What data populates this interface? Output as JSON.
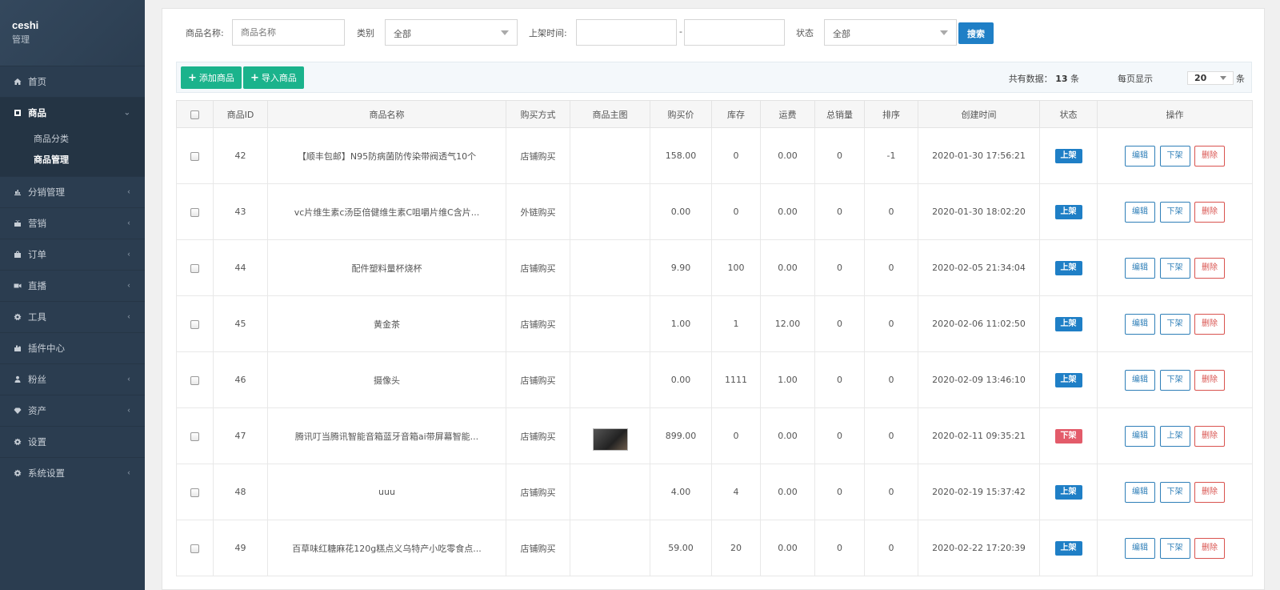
{
  "brand": {
    "name": "ceshi",
    "sub": "管理"
  },
  "sidebar": {
    "items": [
      {
        "key": "home",
        "label": "首页",
        "icon": "home-icon",
        "arrow": false
      },
      {
        "key": "goods",
        "label": "商品",
        "icon": "product-icon",
        "arrow": true,
        "open": true,
        "children": [
          {
            "label": "商品分类"
          },
          {
            "label": "商品管理",
            "active": true
          }
        ]
      },
      {
        "key": "distribution",
        "label": "分销管理",
        "icon": "distribution-icon",
        "arrow": true
      },
      {
        "key": "marketing",
        "label": "营销",
        "icon": "gift-icon",
        "arrow": true
      },
      {
        "key": "orders",
        "label": "订单",
        "icon": "cart-icon",
        "arrow": true
      },
      {
        "key": "live",
        "label": "直播",
        "icon": "video-icon",
        "arrow": true
      },
      {
        "key": "tools",
        "label": "工具",
        "icon": "gear-icon",
        "arrow": true
      },
      {
        "key": "plugins",
        "label": "插件中心",
        "icon": "plugin-icon",
        "arrow": false
      },
      {
        "key": "fans",
        "label": "粉丝",
        "icon": "user-icon",
        "arrow": true
      },
      {
        "key": "assets",
        "label": "资产",
        "icon": "diamond-icon",
        "arrow": true
      },
      {
        "key": "settings",
        "label": "设置",
        "icon": "gear-icon",
        "arrow": false
      },
      {
        "key": "system",
        "label": "系统设置",
        "icon": "gear-icon",
        "arrow": true
      }
    ]
  },
  "filters": {
    "name_label": "商品名称:",
    "name_placeholder": "商品名称",
    "category_label": "类别",
    "category_value": "全部",
    "time_label": "上架时间:",
    "time_separator": "-",
    "status_label": "状态",
    "status_value": "全部",
    "search_label": "搜索"
  },
  "toolbar": {
    "add_label": "添加商品",
    "import_label": "导入商品",
    "total_prefix": "共有数据：",
    "total_count": "13",
    "total_suffix": "条",
    "perpage_label": "每页显示",
    "perpage_value": "20",
    "perpage_unit": "条"
  },
  "table": {
    "headers": [
      "商品ID",
      "商品名称",
      "购买方式",
      "商品主图",
      "购买价",
      "库存",
      "运费",
      "总销量",
      "排序",
      "创建时间",
      "状态",
      "操作"
    ],
    "rows": [
      {
        "id": "42",
        "name": "【顺丰包邮】N95防病菌防传染带阀透气10个",
        "buy": "店铺购买",
        "image": "",
        "price": "158.00",
        "stock": "0",
        "freight": "0.00",
        "sales": "0",
        "sort": "-1",
        "created": "2020-01-30 17:56:21",
        "status": "上架",
        "on": true,
        "edit": "编辑",
        "toggle": "下架",
        "del": "删除"
      },
      {
        "id": "43",
        "name": "vc片维生素c汤臣倍健维生素C咀嚼片维C含片...",
        "buy": "外链购买",
        "image": "",
        "price": "0.00",
        "stock": "0",
        "freight": "0.00",
        "sales": "0",
        "sort": "0",
        "created": "2020-01-30 18:02:20",
        "status": "上架",
        "on": true,
        "edit": "编辑",
        "toggle": "下架",
        "del": "删除"
      },
      {
        "id": "44",
        "name": "配件塑料量杯烧杯",
        "buy": "店铺购买",
        "image": "",
        "price": "9.90",
        "stock": "100",
        "freight": "0.00",
        "sales": "0",
        "sort": "0",
        "created": "2020-02-05 21:34:04",
        "status": "上架",
        "on": true,
        "edit": "编辑",
        "toggle": "下架",
        "del": "删除"
      },
      {
        "id": "45",
        "name": "黄金茶",
        "buy": "店铺购买",
        "image": "",
        "price": "1.00",
        "stock": "1",
        "freight": "12.00",
        "sales": "0",
        "sort": "0",
        "created": "2020-02-06 11:02:50",
        "status": "上架",
        "on": true,
        "edit": "编辑",
        "toggle": "下架",
        "del": "删除"
      },
      {
        "id": "46",
        "name": "摄像头",
        "buy": "店铺购买",
        "image": "",
        "price": "0.00",
        "stock": "1111",
        "freight": "1.00",
        "sales": "0",
        "sort": "0",
        "created": "2020-02-09 13:46:10",
        "status": "上架",
        "on": true,
        "edit": "编辑",
        "toggle": "下架",
        "del": "删除"
      },
      {
        "id": "47",
        "name": "腾讯叮当腾讯智能音箱蓝牙音箱ai带屏幕智能...",
        "buy": "店铺购买",
        "image": "thumbnail",
        "price": "899.00",
        "stock": "0",
        "freight": "0.00",
        "sales": "0",
        "sort": "0",
        "created": "2020-02-11 09:35:21",
        "status": "下架",
        "on": false,
        "edit": "编辑",
        "toggle": "上架",
        "del": "删除"
      },
      {
        "id": "48",
        "name": "uuu",
        "buy": "店铺购买",
        "image": "",
        "price": "4.00",
        "stock": "4",
        "freight": "0.00",
        "sales": "0",
        "sort": "0",
        "created": "2020-02-19 15:37:42",
        "status": "上架",
        "on": true,
        "edit": "编辑",
        "toggle": "下架",
        "del": "删除"
      },
      {
        "id": "49",
        "name": "百草味红糖麻花120g糕点义乌特产小吃零食点...",
        "buy": "店铺购买",
        "image": "",
        "price": "59.00",
        "stock": "20",
        "freight": "0.00",
        "sales": "0",
        "sort": "0",
        "created": "2020-02-22 17:20:39",
        "status": "上架",
        "on": true,
        "edit": "编辑",
        "toggle": "下架",
        "del": "删除"
      }
    ]
  },
  "colors": {
    "sidebar": "#2b3d50",
    "primary": "#1f7fc6",
    "success": "#1bb38c",
    "danger": "#e35b6a"
  }
}
